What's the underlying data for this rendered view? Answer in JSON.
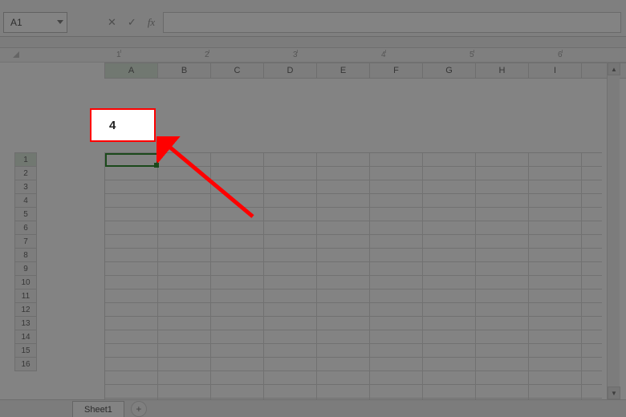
{
  "formulaBar": {
    "nameBox": "A1",
    "fxLabel": "fx",
    "formulaValue": ""
  },
  "columns": [
    "A",
    "B",
    "C",
    "D",
    "E",
    "F",
    "G",
    "H",
    "I"
  ],
  "activeColumn": "A",
  "rows": [
    "1",
    "2",
    "3",
    "4",
    "5",
    "6",
    "7",
    "8",
    "9",
    "10",
    "11",
    "12",
    "13",
    "14",
    "15",
    "16"
  ],
  "activeRow": "1",
  "ghostMarks": [
    "1",
    "2",
    "3",
    "4",
    "5",
    "6"
  ],
  "tabs": {
    "active": "Sheet1",
    "addLabel": "+"
  },
  "callout": {
    "value": "4"
  }
}
